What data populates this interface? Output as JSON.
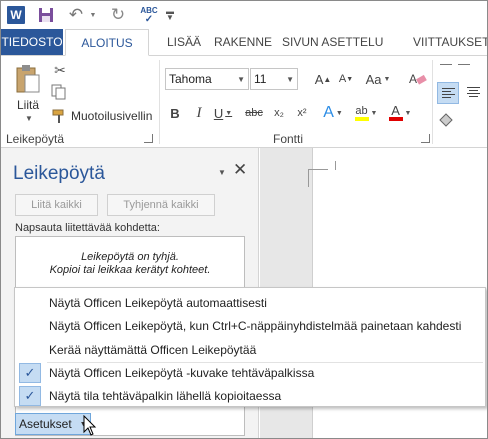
{
  "qat": {
    "app_icon": "W",
    "spell_label": "ABC"
  },
  "tabs": [
    {
      "label": "TIEDOSTO"
    },
    {
      "label": "ALOITUS"
    },
    {
      "label": "LISÄÄ"
    },
    {
      "label": "RAKENNE"
    },
    {
      "label": "SIVUN ASETTELU"
    },
    {
      "label": "VIITTAUKSET"
    }
  ],
  "ribbon": {
    "clipboard": {
      "paste_label": "Liitä",
      "format_painter_label": "Muotoilusivellin",
      "group_label": "Leikepöytä"
    },
    "font": {
      "font_name": "Tahoma",
      "font_size": "11",
      "group_label": "Fontti",
      "grow_label": "A",
      "shrink_label": "A",
      "case_label": "Aa",
      "bold": "B",
      "italic": "I",
      "underline": "U",
      "strike": "abc",
      "subscript": "x₂",
      "superscript": "x²",
      "effects": "A",
      "highlight": "ab",
      "font_color": "A"
    }
  },
  "pane": {
    "title": "Leikepöytä",
    "paste_all": "Liitä kaikki",
    "clear_all": "Tyhjennä kaikki",
    "instruction": "Napsauta liitettävää kohdetta:",
    "empty_line1": "Leikepöytä on tyhjä.",
    "empty_line2": "Kopioi tai leikkaa kerätyt kohteet.",
    "options_label": "Asetukset"
  },
  "menu": {
    "items": [
      {
        "label": "Näytä Officen Leikepöytä automaattisesti",
        "checked": false
      },
      {
        "label": "Näytä Officen Leikepöytä, kun Ctrl+C-näppäinyhdistelmää painetaan kahdesti",
        "checked": false
      },
      {
        "label": "Kerää näyttämättä Officen Leikepöytää",
        "checked": false
      },
      {
        "label": "Näytä Officen Leikepöytä -kuvake tehtäväpalkissa",
        "checked": true
      },
      {
        "label": "Näytä tila tehtäväpalkin lähellä kopioitaessa",
        "checked": true
      }
    ]
  },
  "colors": {
    "accent": "#2b579a",
    "highlight_yellow": "#ffff00",
    "font_color_red": "#e00000",
    "checked_bg": "#c5dcf3"
  }
}
